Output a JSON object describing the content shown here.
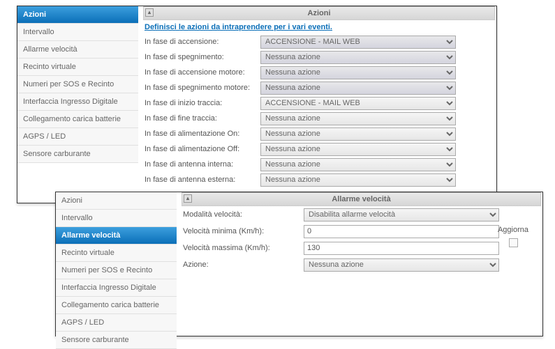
{
  "top": {
    "section_title": "Azioni",
    "instruction": "Definisci le azioni da intraprendere per i vari eventi.",
    "sidebar": [
      "Azioni",
      "Intervallo",
      "Allarme velocità",
      "Recinto virtuale",
      "Numeri per SOS e Recinto",
      "Interfaccia Ingresso Digitale",
      "Collegamento carica batterie",
      "AGPS / LED",
      "Sensore carburante"
    ],
    "active_index": 0,
    "rows": [
      {
        "label": "In fase di accensione:",
        "value": "ACCENSIONE - MAIL WEB",
        "hl": true
      },
      {
        "label": "In fase di spegnimento:",
        "value": "Nessuna azione",
        "hl": true
      },
      {
        "label": "In fase di accensione motore:",
        "value": "Nessuna azione",
        "hl": true
      },
      {
        "label": "In fase di spegnimento motore:",
        "value": "Nessuna azione",
        "hl": true
      },
      {
        "label": "In fase di inizio traccia:",
        "value": "ACCENSIONE - MAIL WEB",
        "hl": false
      },
      {
        "label": "In fase di fine traccia:",
        "value": "Nessuna azione",
        "hl": false
      },
      {
        "label": "In fase di alimentazione On:",
        "value": "Nessuna azione",
        "hl": false
      },
      {
        "label": "In fase di alimentazione Off:",
        "value": "Nessuna azione",
        "hl": false
      },
      {
        "label": "In fase di antenna interna:",
        "value": "Nessuna azione",
        "hl": false
      },
      {
        "label": "In fase di antenna esterna:",
        "value": "Nessuna azione",
        "hl": false
      }
    ]
  },
  "bottom": {
    "section_title": "Allarme velocità",
    "sidebar": [
      "Azioni",
      "Intervallo",
      "Allarme velocità",
      "Recinto virtuale",
      "Numeri per SOS e Recinto",
      "Interfaccia Ingresso Digitale",
      "Collegamento carica batterie",
      "AGPS / LED",
      "Sensore carburante"
    ],
    "active_index": 2,
    "mode_label": "Modalità velocità:",
    "mode_value": "Disabilita allarme velocità",
    "min_label": "Velocità minima (Km/h):",
    "min_value": "0",
    "max_label": "Velocità massima (Km/h):",
    "max_value": "130",
    "action_label": "Azione:",
    "action_value": "Nessuna azione",
    "update_label": "Aggiorna"
  }
}
